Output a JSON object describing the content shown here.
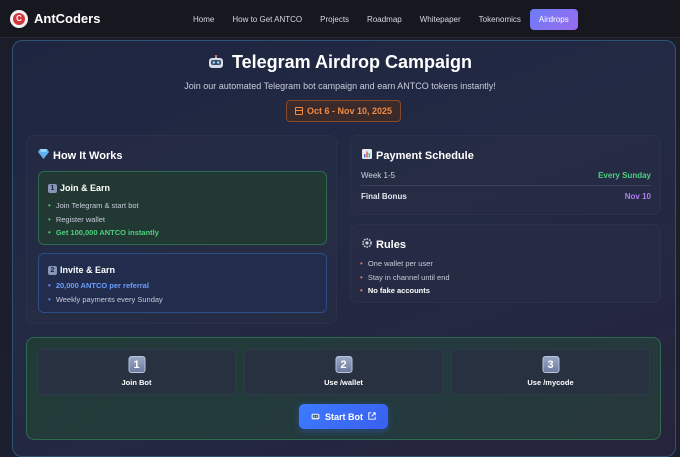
{
  "nav": {
    "brand": "AntCoders",
    "logo_letter": "C",
    "links": [
      {
        "label": "Home",
        "active": false
      },
      {
        "label": "How to Get ANTCO",
        "active": false
      },
      {
        "label": "Projects",
        "active": false
      },
      {
        "label": "Roadmap",
        "active": false
      },
      {
        "label": "Whitepaper",
        "active": false
      },
      {
        "label": "Tokenomics",
        "active": false
      },
      {
        "label": "Airdrops",
        "active": true
      }
    ]
  },
  "hero": {
    "title": "Telegram Airdrop Campaign",
    "title_icon": "robot-icon",
    "subtitle": "Join our automated Telegram bot campaign and earn ANTCO tokens instantly!",
    "date_range": "Oct 6 - Nov 10, 2025"
  },
  "how_it_works": {
    "title": "How It Works",
    "icon": "gem-icon",
    "join": {
      "number": "1",
      "title": "Join & Earn",
      "items": [
        "Join Telegram & start bot",
        "Register wallet",
        "Get 100,000 ANTCO instantly"
      ]
    },
    "invite": {
      "number": "2",
      "title": "Invite & Earn",
      "items": [
        "20,000 ANTCO per referral",
        "Weekly payments every Sunday"
      ]
    }
  },
  "payment": {
    "title": "Payment Schedule",
    "icon": "bar-chart-icon",
    "rows": [
      {
        "label": "Week 1-5",
        "value": "Every Sunday"
      },
      {
        "label": "Final Bonus",
        "value": "Nov 10"
      }
    ]
  },
  "rules": {
    "title": "Rules",
    "icon": "gear-icon",
    "items": [
      "One wallet per user",
      "Stay in channel until end",
      "No fake accounts"
    ]
  },
  "steps": [
    {
      "number": "1",
      "label": "Join Bot"
    },
    {
      "number": "2",
      "label": "Use /wallet"
    },
    {
      "number": "3",
      "label": "Use /mycode"
    }
  ],
  "cta": {
    "label": "Start Bot",
    "icon": "robot-icon"
  },
  "colors": {
    "accent_green": "#4cd07e",
    "accent_blue": "#6aa0ff",
    "accent_purple": "#b07cf5",
    "accent_orange": "#f08a45",
    "cta_blue": "#3d7bff"
  }
}
